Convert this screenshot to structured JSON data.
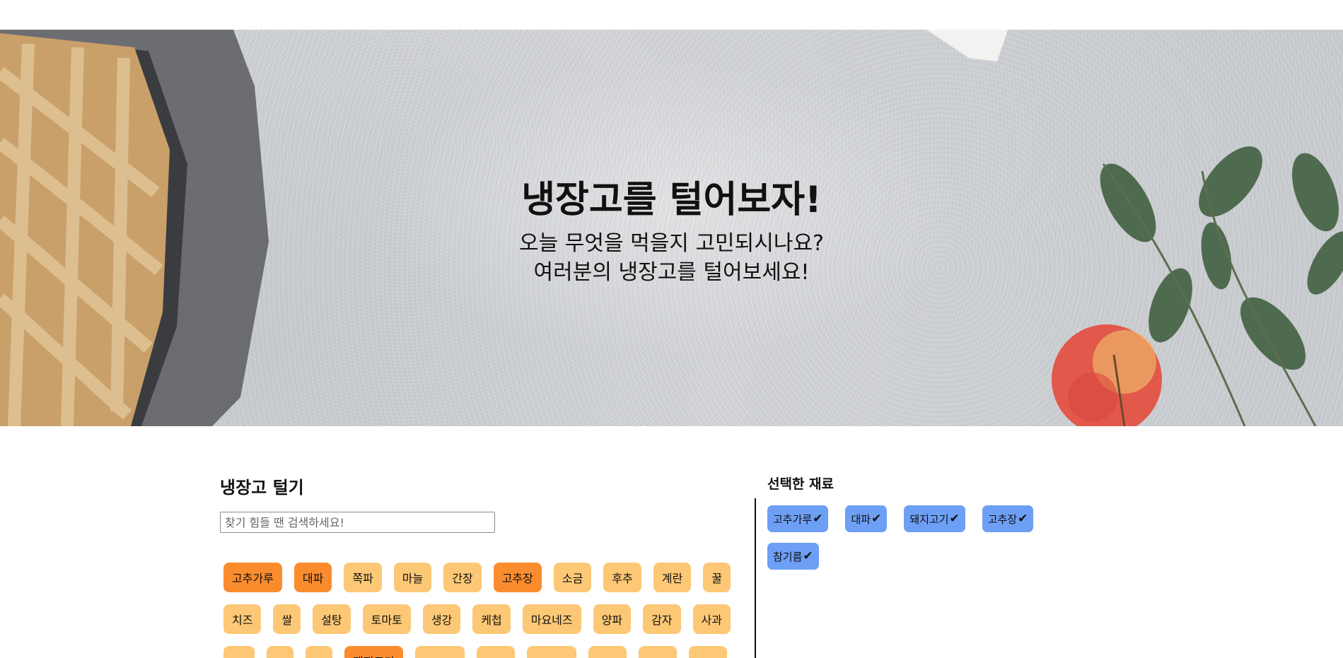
{
  "hero": {
    "title": "냉장고를 털어보자!",
    "subtitle_line1": "오늘 무엇을 먹을지 고민되시나요?",
    "subtitle_line2": "여러분의 냉장고를 털어보세요!"
  },
  "ingredients": {
    "title": "냉장고 털기",
    "search_placeholder": "찾기 힘들 땐 검색하세요!",
    "rows": [
      [
        {
          "label": "고추가루",
          "selected": true
        },
        {
          "label": "대파",
          "selected": true
        },
        {
          "label": "쪽파",
          "selected": false
        },
        {
          "label": "마늘",
          "selected": false
        },
        {
          "label": "간장",
          "selected": false
        },
        {
          "label": "고추장",
          "selected": true
        },
        {
          "label": "소금",
          "selected": false
        },
        {
          "label": "후추",
          "selected": false
        },
        {
          "label": "계란",
          "selected": false
        },
        {
          "label": "꿀",
          "selected": false
        }
      ],
      [
        {
          "label": "치즈",
          "selected": false
        },
        {
          "label": "쌀",
          "selected": false
        },
        {
          "label": "설탕",
          "selected": false
        },
        {
          "label": "토마토",
          "selected": false
        },
        {
          "label": "생강",
          "selected": false
        },
        {
          "label": "케첩",
          "selected": false
        },
        {
          "label": "마요네즈",
          "selected": false
        },
        {
          "label": "양파",
          "selected": false
        },
        {
          "label": "감자",
          "selected": false
        },
        {
          "label": "사과",
          "selected": false
        }
      ],
      [
        {
          "label": "",
          "selected": false
        },
        {
          "label": "",
          "selected": false
        },
        {
          "label": "",
          "selected": false
        },
        {
          "label": "돼지고기",
          "selected": true
        },
        {
          "label": "",
          "selected": false
        },
        {
          "label": "",
          "selected": false
        },
        {
          "label": "",
          "selected": false
        },
        {
          "label": "",
          "selected": false
        },
        {
          "label": "",
          "selected": false
        },
        {
          "label": "",
          "selected": false
        }
      ]
    ]
  },
  "selected": {
    "title": "선택한 재료",
    "check_icon": "✔",
    "rows": [
      [
        "고추가루",
        "대파",
        "돼지고기",
        "고추장"
      ],
      [
        "참기름"
      ]
    ]
  }
}
